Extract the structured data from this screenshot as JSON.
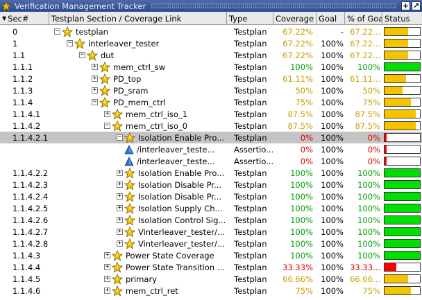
{
  "window": {
    "title": "Verification Management Tracker",
    "icon": "star-icon",
    "buttons": [
      "+",
      "↗"
    ]
  },
  "columns": {
    "sec": "Sec#",
    "section": "Testplan Section / Coverage Link",
    "type": "Type",
    "coverage": "Coverage",
    "goal": "Goal",
    "pct_goal": "% of Goa",
    "status": "Status",
    "sort_indicator": "▼"
  },
  "colors": {
    "yellow": "#f5c400",
    "green": "#00e000",
    "red": "#ff0000",
    "selected_row": "#c4c4c4"
  },
  "rows": [
    {
      "sec": "0",
      "level": 0,
      "expander": "−",
      "icon": "star",
      "label": "testplan",
      "type": "Testplan",
      "coverage": "67.22%",
      "goal": "-",
      "pct": "67.22...",
      "color": "yellow",
      "fill": 0.67
    },
    {
      "sec": "1",
      "level": 1,
      "expander": "−",
      "icon": "star",
      "label": "interleaver_tester",
      "type": "Testplan",
      "coverage": "67.22%",
      "goal": "100%",
      "pct": "67.22...",
      "color": "yellow",
      "fill": 0.67
    },
    {
      "sec": "1.1",
      "level": 2,
      "expander": "−",
      "icon": "star",
      "label": "dut",
      "type": "Testplan",
      "coverage": "67.22%",
      "goal": "100%",
      "pct": "67.22...",
      "color": "yellow",
      "fill": 0.67
    },
    {
      "sec": "1.1.1",
      "level": 3,
      "expander": "+",
      "icon": "star",
      "label": "mem_ctrl_sw",
      "type": "Testplan",
      "coverage": "100%",
      "goal": "100%",
      "pct": "100%",
      "color": "green",
      "fill": 1.0
    },
    {
      "sec": "1.1.2",
      "level": 3,
      "expander": "+",
      "icon": "star",
      "label": "PD_top",
      "type": "Testplan",
      "coverage": "61.11%",
      "goal": "100%",
      "pct": "61.11...",
      "color": "yellow",
      "fill": 0.61
    },
    {
      "sec": "1.1.3",
      "level": 3,
      "expander": "+",
      "icon": "star",
      "label": "PD_sram",
      "type": "Testplan",
      "coverage": "50%",
      "goal": "100%",
      "pct": "50%",
      "color": "yellow",
      "fill": 0.5
    },
    {
      "sec": "1.1.4",
      "level": 3,
      "expander": "−",
      "icon": "star",
      "label": "PD_mem_ctrl",
      "type": "Testplan",
      "coverage": "75%",
      "goal": "100%",
      "pct": "75%",
      "color": "yellow",
      "fill": 0.75
    },
    {
      "sec": "1.1.4.1",
      "level": 4,
      "expander": "+",
      "icon": "star",
      "label": "mem_ctrl_iso_1",
      "type": "Testplan",
      "coverage": "87.5%",
      "goal": "100%",
      "pct": "87.5%",
      "color": "yellow",
      "fill": 0.875
    },
    {
      "sec": "1.1.4.2",
      "level": 4,
      "expander": "−",
      "icon": "star",
      "label": "mem_ctrl_iso_0",
      "type": "Testplan",
      "coverage": "87.5%",
      "goal": "100%",
      "pct": "87.5%",
      "color": "yellow",
      "fill": 0.875
    },
    {
      "sec": "1.1.4.2.1",
      "level": 5,
      "expander": "−",
      "icon": "star",
      "label": "Isolation Enable Pro...",
      "type": "Testplan",
      "coverage": "0%",
      "goal": "100%",
      "pct": "0%",
      "color": "red",
      "fill": 0.0,
      "selected": true
    },
    {
      "sec": "",
      "level": 6,
      "expander": "",
      "icon": "triangle",
      "label": "/interleaver_teste...",
      "type": "Assertio...",
      "coverage": "0%",
      "goal": "100%",
      "pct": "0%",
      "color": "red",
      "fill": 0.0
    },
    {
      "sec": "",
      "level": 6,
      "expander": "",
      "icon": "triangle",
      "label": "/interleaver_teste...",
      "type": "Assertio...",
      "coverage": "0%",
      "goal": "100%",
      "pct": "0%",
      "color": "red",
      "fill": 0.0
    },
    {
      "sec": "1.1.4.2.2",
      "level": 5,
      "expander": "+",
      "icon": "star",
      "label": "Isolation Enable Pro...",
      "type": "Testplan",
      "coverage": "100%",
      "goal": "100%",
      "pct": "100%",
      "color": "green",
      "fill": 1.0
    },
    {
      "sec": "1.1.4.2.3",
      "level": 5,
      "expander": "+",
      "icon": "star",
      "label": "Isolation Disable Pr...",
      "type": "Testplan",
      "coverage": "100%",
      "goal": "100%",
      "pct": "100%",
      "color": "green",
      "fill": 1.0
    },
    {
      "sec": "1.1.4.2.4",
      "level": 5,
      "expander": "+",
      "icon": "star",
      "label": "Isolation Disable Pr...",
      "type": "Testplan",
      "coverage": "100%",
      "goal": "100%",
      "pct": "100%",
      "color": "green",
      "fill": 1.0
    },
    {
      "sec": "1.1.4.2.5",
      "level": 5,
      "expander": "+",
      "icon": "star",
      "label": "Isolation Supply Ch...",
      "type": "Testplan",
      "coverage": "100%",
      "goal": "100%",
      "pct": "100%",
      "color": "green",
      "fill": 1.0
    },
    {
      "sec": "1.1.4.2.6",
      "level": 5,
      "expander": "+",
      "icon": "star",
      "label": "Isolation Control Sig...",
      "type": "Testplan",
      "coverage": "100%",
      "goal": "100%",
      "pct": "100%",
      "color": "green",
      "fill": 1.0
    },
    {
      "sec": "1.1.4.2.7",
      "level": 5,
      "expander": "+",
      "icon": "star",
      "label": "Vinterleaver_tester/...",
      "type": "Testplan",
      "coverage": "100%",
      "goal": "100%",
      "pct": "100%",
      "color": "green",
      "fill": 1.0
    },
    {
      "sec": "1.1.4.2.8",
      "level": 5,
      "expander": "+",
      "icon": "star",
      "label": "Vinterleaver_tester/...",
      "type": "Testplan",
      "coverage": "100%",
      "goal": "100%",
      "pct": "100%",
      "color": "green",
      "fill": 1.0
    },
    {
      "sec": "1.1.4.3",
      "level": 4,
      "expander": "+",
      "icon": "star",
      "label": "Power State Coverage",
      "type": "Testplan",
      "coverage": "100%",
      "goal": "100%",
      "pct": "100%",
      "color": "green",
      "fill": 1.0
    },
    {
      "sec": "1.1.4.4",
      "level": 4,
      "expander": "+",
      "icon": "star",
      "label": "Power State Transition ...",
      "type": "Testplan",
      "coverage": "33.33%",
      "goal": "100%",
      "pct": "33.33...",
      "color": "red",
      "fill": 0.33
    },
    {
      "sec": "1.1.4.5",
      "level": 4,
      "expander": "+",
      "icon": "star",
      "label": "primary",
      "type": "Testplan",
      "coverage": "66.66%",
      "goal": "100%",
      "pct": "66.66...",
      "color": "yellow",
      "fill": 0.67
    },
    {
      "sec": "1.1.4.6",
      "level": 4,
      "expander": "+",
      "icon": "star",
      "label": "mem_ctrl_ret",
      "type": "Testplan",
      "coverage": "75%",
      "goal": "100%",
      "pct": "75%",
      "color": "yellow",
      "fill": 0.75
    }
  ]
}
